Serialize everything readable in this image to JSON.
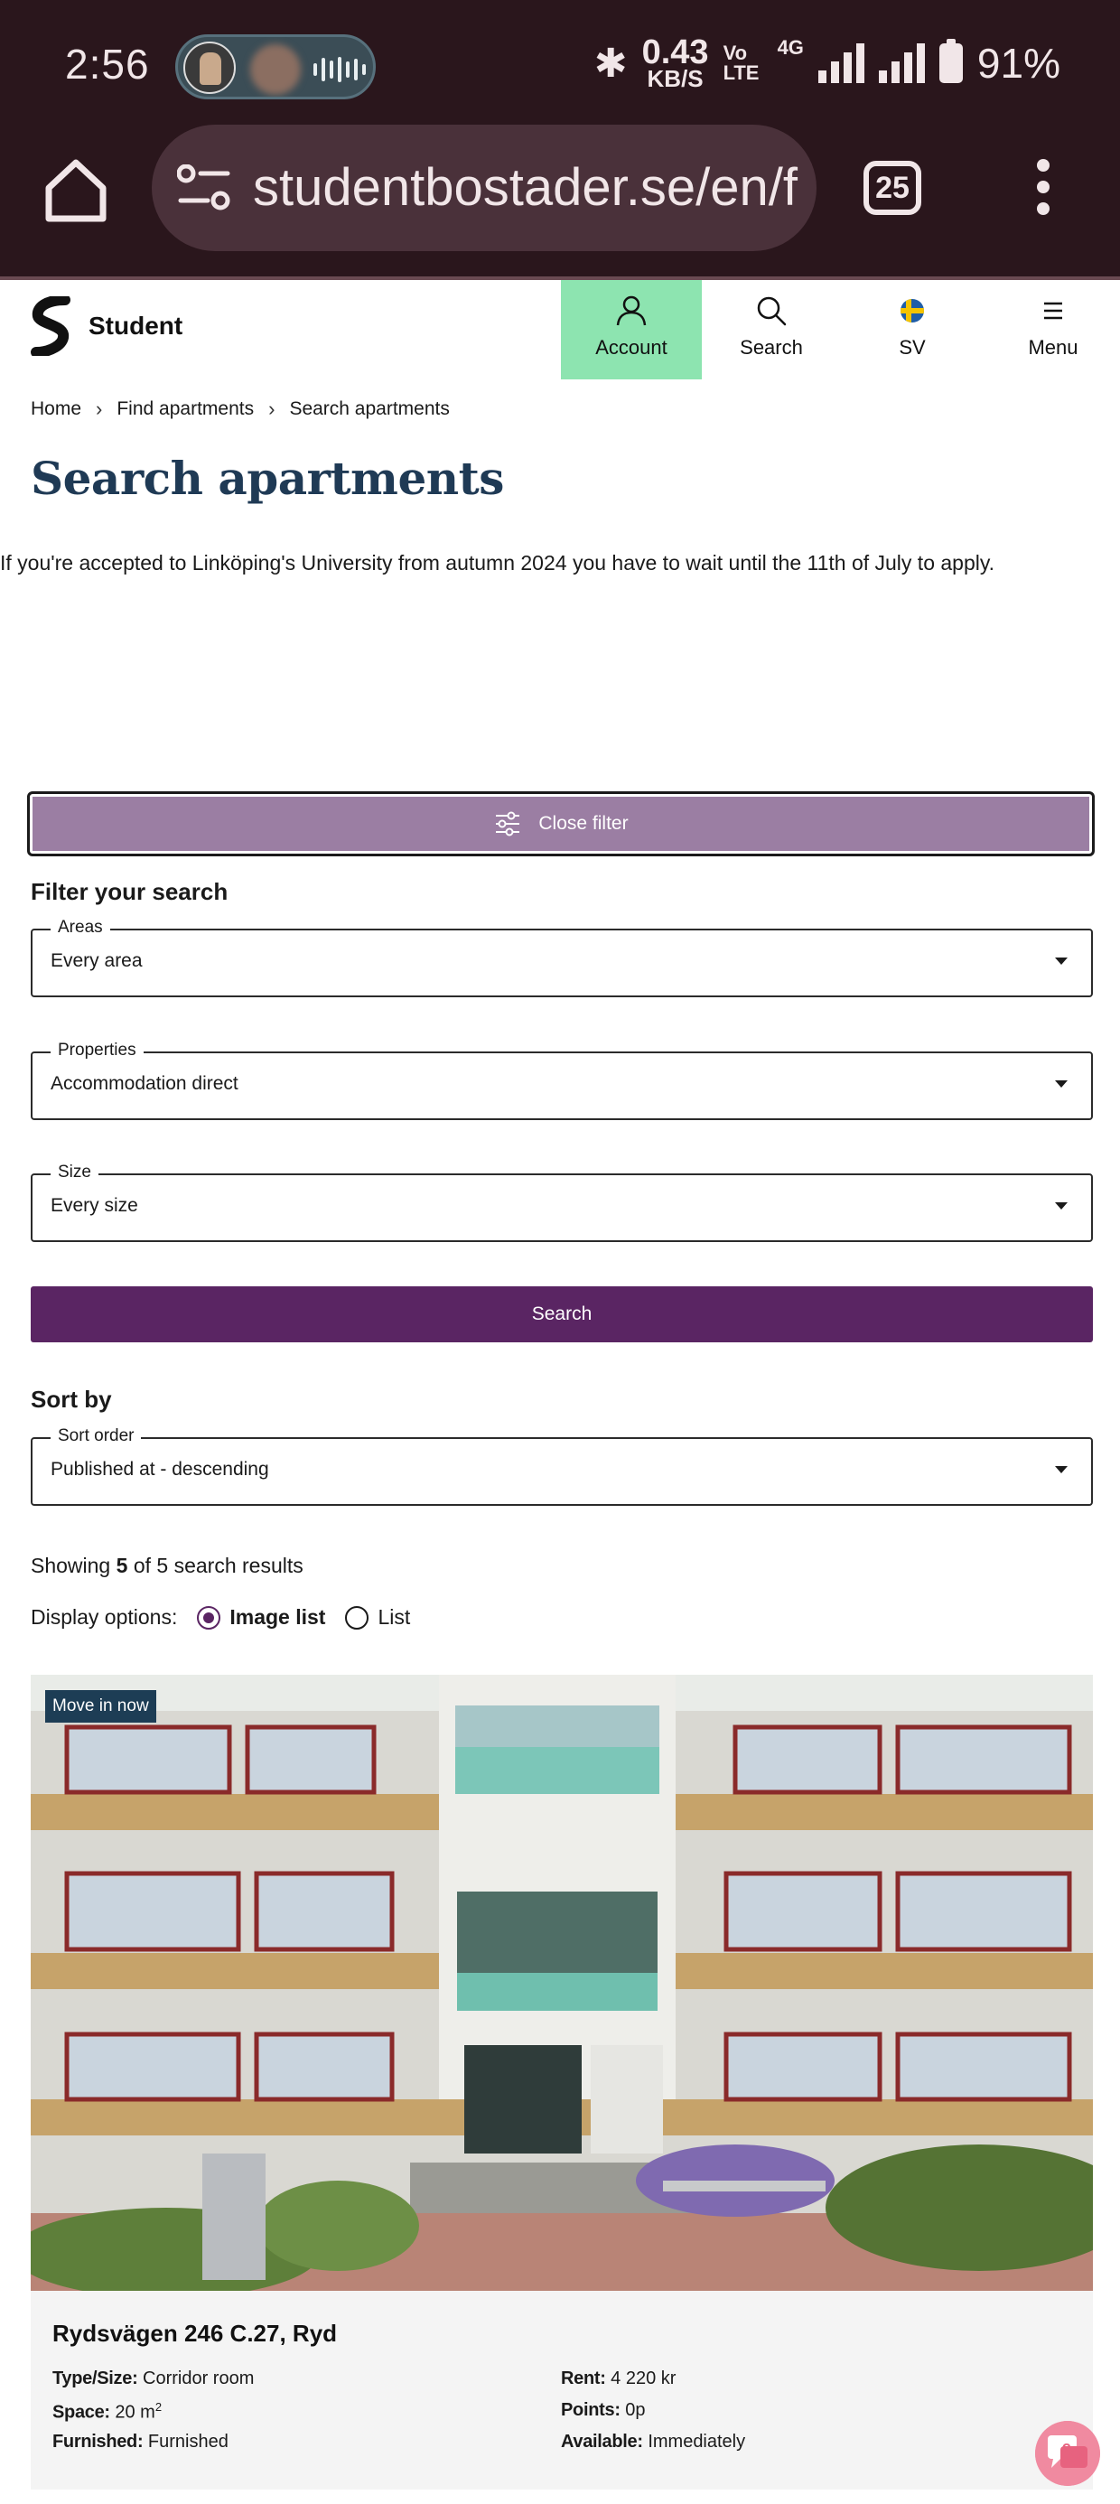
{
  "status_bar": {
    "time": "2:56",
    "net_speed_value": "0.43",
    "net_speed_unit": "KB/S",
    "volte": "Vo LTE",
    "network": "4G",
    "battery": "91%"
  },
  "browser": {
    "url": "studentbostader.se/en/find-apartments",
    "tab_count": "25"
  },
  "header": {
    "logo_text": "Student",
    "nav": {
      "account": "Account",
      "search": "Search",
      "language": "SV",
      "menu": "Menu"
    },
    "active_color": "#8de4b0"
  },
  "breadcrumb": [
    "Home",
    "Find apartments",
    "Search apartments"
  ],
  "page": {
    "title": "Search apartments",
    "notice": "If you're accepted to Linköping's University from autumn 2024 you have to wait until the 11th of July to apply."
  },
  "filter": {
    "toggle_label": "Close filter",
    "heading": "Filter your search",
    "fields": [
      {
        "label": "Areas",
        "value": "Every area"
      },
      {
        "label": "Properties",
        "value": "Accommodation direct"
      },
      {
        "label": "Size",
        "value": "Every size"
      }
    ],
    "search_label": "Search"
  },
  "sort": {
    "heading": "Sort by",
    "label": "Sort order",
    "value": "Published at - descending"
  },
  "results": {
    "prefix": "Showing",
    "shown": "5",
    "of": "of",
    "total": "5",
    "suffix": "search results",
    "display_label": "Display options:",
    "options": [
      {
        "label": "Image list",
        "selected": true
      },
      {
        "label": "List",
        "selected": false
      }
    ]
  },
  "listing": {
    "badge": "Move in now",
    "title": "Rydsvägen 246 C.27, Ryd",
    "details": {
      "type_label": "Type/Size:",
      "type_value": "Corridor room",
      "space_label": "Space:",
      "space_value": "20 m",
      "space_sup": "2",
      "furnished_label": "Furnished:",
      "furnished_value": "Furnished",
      "rent_label": "Rent:",
      "rent_value": "4 220 kr",
      "points_label": "Points:",
      "points_value": "0p",
      "available_label": "Available:",
      "available_value": "Immediately"
    }
  },
  "colors": {
    "chrome_bg": "#2a161c",
    "brand_purple": "#5a2563",
    "filter_purple": "#9b7ea3",
    "title_navy": "#1f3a55",
    "badge_navy": "#1d3d55"
  },
  "icons": {
    "home": "home-icon",
    "site_settings": "tune-icon",
    "account": "user-icon",
    "search": "search-icon",
    "language": "sweden-flag-icon",
    "menu": "hamburger-icon",
    "filter": "sliders-icon",
    "chat": "chat-help-icon"
  }
}
